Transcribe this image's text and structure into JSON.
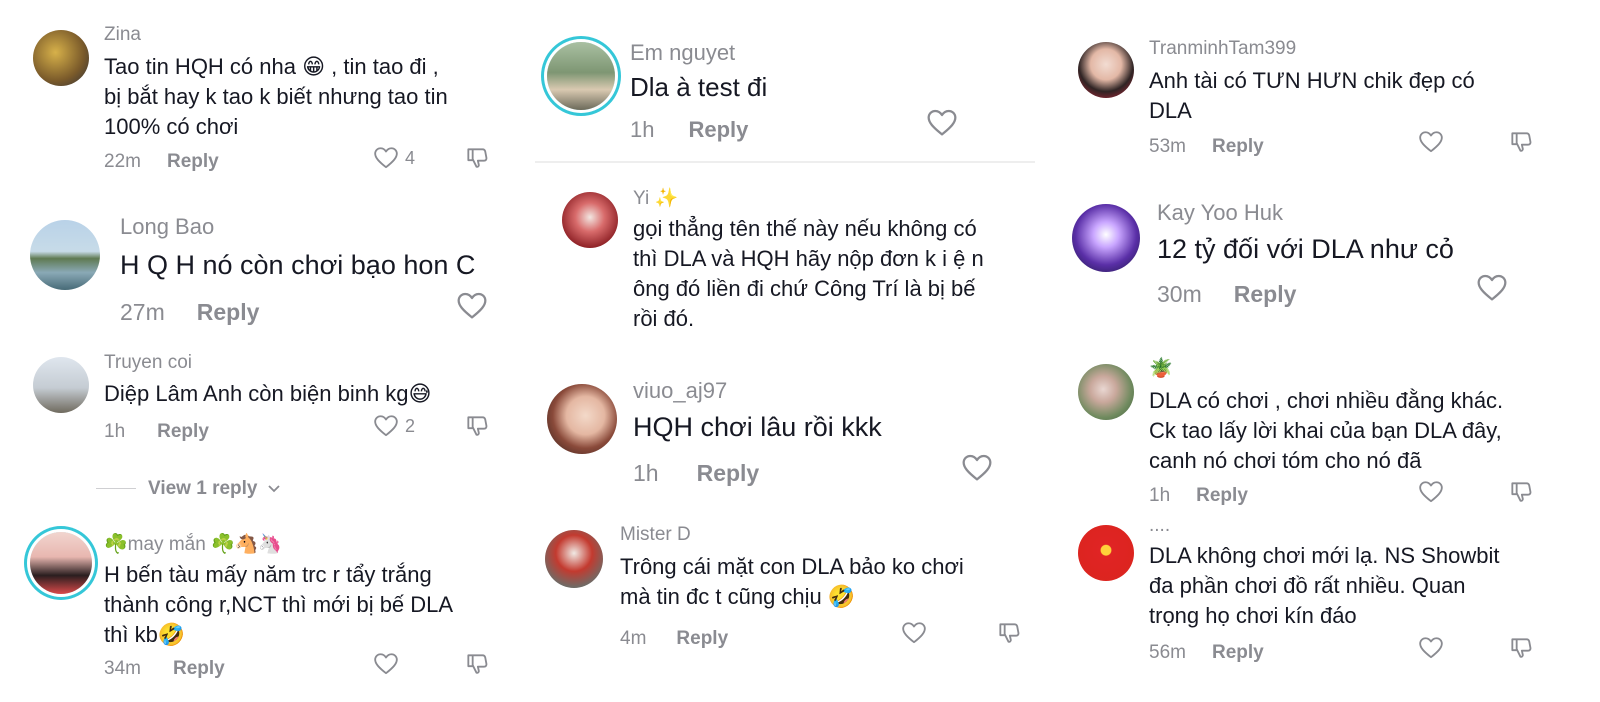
{
  "columns": [
    {
      "comments": [
        {
          "user": "Zina",
          "text": "Tao tin HQH có nha 😁 , tin tao đi ,\nbị bắt hay k tao k biết nhưng tao tin\n100% có chơi",
          "time": "22m",
          "reply": "Reply",
          "likes": "4"
        },
        {
          "user": "Long Bao",
          "text": "H Q H nó còn chơi bạo hon C",
          "time": "27m",
          "reply": "Reply",
          "likes": ""
        },
        {
          "user": "Truyen coi",
          "text": "Diệp Lâm Anh còn biện binh kg😅",
          "time": "1h",
          "reply": "Reply",
          "likes": "2"
        },
        {
          "user": "☘️may mắn ☘️🐴🦄",
          "text": "H bến tàu mấy năm trc r tẩy trắng\nthành công r,NCT thì mới bị bế DLA\nthì kb🤣",
          "time": "34m",
          "reply": "Reply",
          "likes": ""
        }
      ],
      "view_replies": "View 1 reply"
    },
    {
      "comments": [
        {
          "user": "Em nguyet",
          "text": "Dla à test đi",
          "time": "1h",
          "reply": "Reply",
          "likes": ""
        },
        {
          "user": "Yi ✨",
          "text": "gọi thẳng tên thế này nếu không có\nthì DLA và HQH hãy nộp đơn k i ệ n\nông đó liền đi chứ Công Trí là bị bế\nrồi đó.",
          "time": "",
          "reply": "",
          "likes": ""
        },
        {
          "user": "viuo_aj97",
          "text": "HQH chơi lâu rồi kkk",
          "time": "1h",
          "reply": "Reply",
          "likes": ""
        },
        {
          "user": "Mister D",
          "text": "Trông cái mặt con DLA bảo ko chơi\nmà tin đc t cũng chịu 🤣",
          "time": "4m",
          "reply": "Reply",
          "likes": ""
        }
      ]
    },
    {
      "comments": [
        {
          "user": "TranminhTam399",
          "text": "Anh tài có TƯN HƯN chik đẹp có\nDLA",
          "time": "53m",
          "reply": "Reply",
          "likes": ""
        },
        {
          "user": "Kay Yoo Huk",
          "text": "12 tỷ đối với DLA như cỏ",
          "time": "30m",
          "reply": "Reply",
          "likes": ""
        },
        {
          "user": "🪴",
          "text": "DLA có chơi , chơi nhiều đằng khác.\nCk tao lấy lời khai của bạn DLA đây,\ncanh nó chơi tóm cho nó đã",
          "time": "1h",
          "reply": "Reply",
          "likes": ""
        },
        {
          "user": "....",
          "text": "DLA không chơi mới lạ. NS Showbit\nđa phần chơi đồ rất nhiều. Quan\ntrọng họ chơi kín đáo",
          "time": "56m",
          "reply": "Reply",
          "likes": ""
        }
      ]
    }
  ],
  "colors": {
    "text": "#161823",
    "muted": "#8a8b91",
    "ring": "#35c7d8",
    "divider": "#eeeeee"
  },
  "icons": {
    "like": "heart-outline-icon",
    "dislike": "thumbs-down-outline-icon",
    "chevron": "chevron-down-icon"
  }
}
